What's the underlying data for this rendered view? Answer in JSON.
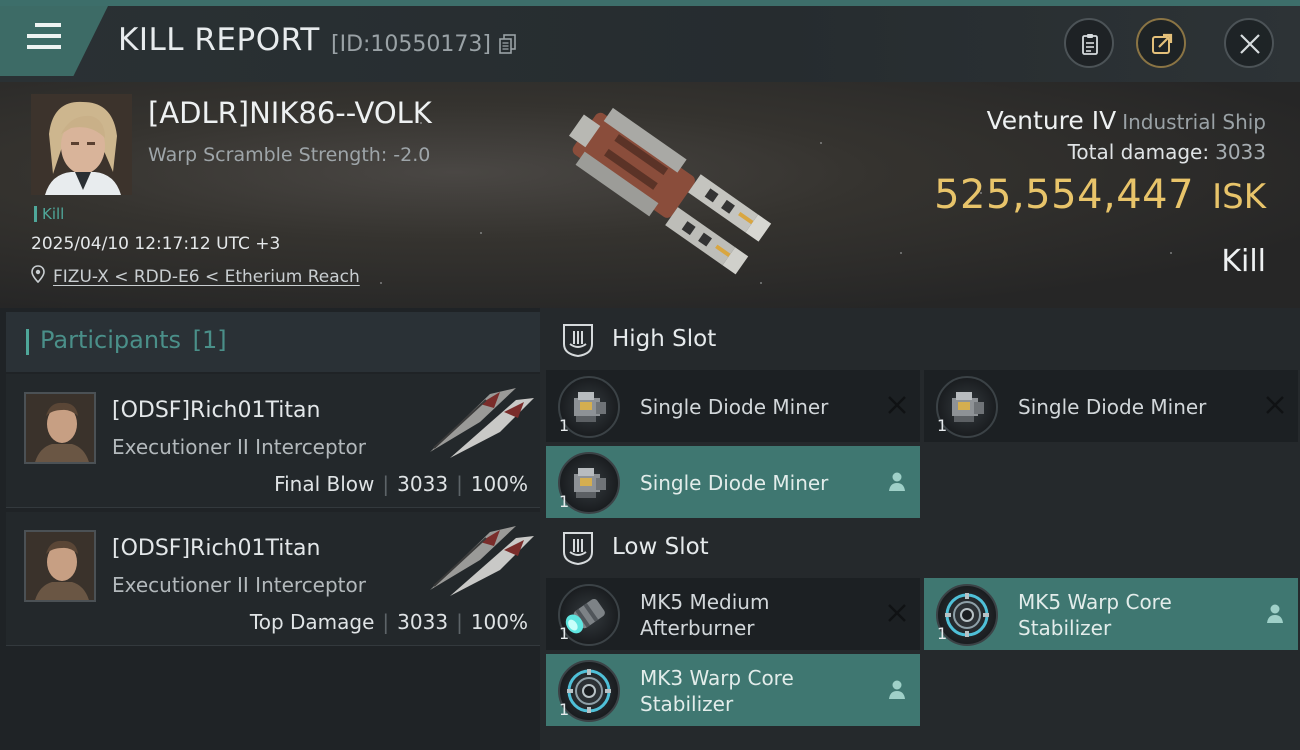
{
  "header": {
    "title": "KILL REPORT",
    "report_id": "[ID:10550173]",
    "buttons": [
      "clipboard-icon",
      "share-icon",
      "close-icon"
    ]
  },
  "victim": {
    "name": "[ADLR]NIK86--VOLK",
    "warp_scramble": "Warp Scramble Strength: -2.0",
    "tag": "Kill",
    "datetime": "2025/04/10 12:17:12 UTC +3",
    "location": "FIZU-X < RDD-E6 < Etherium Reach",
    "ship_name": "Venture IV",
    "ship_class": "Industrial Ship",
    "total_damage_label": "Total damage:",
    "total_damage": "3033",
    "isk_value": "525,554,447",
    "isk_unit": "ISK",
    "result": "Kill"
  },
  "participants": {
    "heading": "Participants",
    "count": "[1]",
    "rows": [
      {
        "name": "[ODSF]Rich01Titan",
        "ship": "Executioner II Interceptor",
        "role": "Final Blow",
        "damage": "3033",
        "percent": "100%"
      },
      {
        "name": "[ODSF]Rich01Titan",
        "ship": "Executioner II Interceptor",
        "role": "Top Damage",
        "damage": "3033",
        "percent": "100%"
      }
    ]
  },
  "fitting": {
    "high_slot": {
      "label": "High Slot",
      "modules": [
        {
          "name": "Single Diode Miner",
          "qty": "1",
          "state": "destroyed"
        },
        {
          "name": "Single Diode Miner",
          "qty": "1",
          "state": "destroyed"
        },
        {
          "name": "Single Diode Miner",
          "qty": "1",
          "state": "dropped"
        }
      ]
    },
    "low_slot": {
      "label": "Low Slot",
      "modules": [
        {
          "name_line1": "MK5 Medium",
          "name_line2": "Afterburner",
          "qty": "1",
          "state": "destroyed"
        },
        {
          "name_line1": "MK5 Warp Core",
          "name_line2": "Stabilizer",
          "qty": "1",
          "state": "dropped"
        },
        {
          "name_line1": "MK3 Warp Core",
          "name_line2": "Stabilizer",
          "qty": "1",
          "state": "dropped"
        }
      ]
    }
  },
  "colors": {
    "accent_teal": "#3f7771",
    "isk_gold": "#e8c46a",
    "background": "#1c1f22"
  }
}
